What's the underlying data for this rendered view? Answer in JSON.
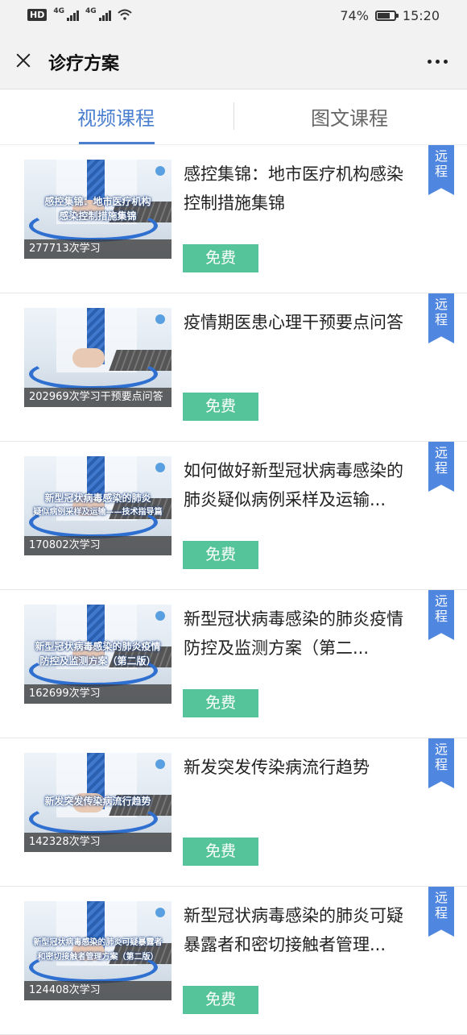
{
  "status_bar": {
    "network_a": "4G",
    "network_b": "4G",
    "battery_text": "74%",
    "battery_level": 0.74,
    "time": "15:20"
  },
  "titlebar": {
    "title": "诊疗方案"
  },
  "tabs": [
    {
      "label": "视频课程",
      "active": true
    },
    {
      "label": "图文课程",
      "active": false
    }
  ],
  "courses": [
    {
      "title": "感控集锦：地市医疗机构感染控制措施集锦",
      "count": "277713次学习",
      "badge": "免费",
      "tag": "远程",
      "thumb_caption_lines": [
        "感控集锦：地市医疗机构",
        "感染控制措施集锦"
      ]
    },
    {
      "title": "疫情期医患心理干预要点问答",
      "count": "202969次学习干预要点问答",
      "badge": "免费",
      "tag": "远程",
      "thumb_caption_lines": []
    },
    {
      "title": "如何做好新型冠状病毒感染的肺炎疑似病例采样及运输...",
      "count": "170802次学习",
      "badge": "免费",
      "tag": "远程",
      "thumb_caption_lines": [
        "新型冠状病毒感染的肺炎",
        "疑似病例采样及运输——技术指导篇"
      ]
    },
    {
      "title": "新型冠状病毒感染的肺炎疫情防控及监测方案（第二...",
      "count": "162699次学习",
      "badge": "免费",
      "tag": "远程",
      "thumb_caption_lines": [
        "新型冠状病毒感染的肺炎疫情",
        "防控及监测方案（第二版）"
      ]
    },
    {
      "title": "新发突发传染病流行趋势",
      "count": "142328次学习",
      "badge": "免费",
      "tag": "远程",
      "thumb_caption_lines": [
        "新发突发传染病流行趋势"
      ]
    },
    {
      "title": "新型冠状病毒感染的肺炎可疑暴露者和密切接触者管理...",
      "count": "124408次学习",
      "badge": "免费",
      "tag": "远程",
      "thumb_caption_lines": [
        "新型冠状病毒感染的肺炎可疑暴露者",
        "和密切接触者管理方案（第二版）"
      ]
    }
  ],
  "colors": {
    "accent_blue": "#4a7fcf",
    "free_green": "#56c49a",
    "ribbon_blue": "#4f86e0"
  }
}
